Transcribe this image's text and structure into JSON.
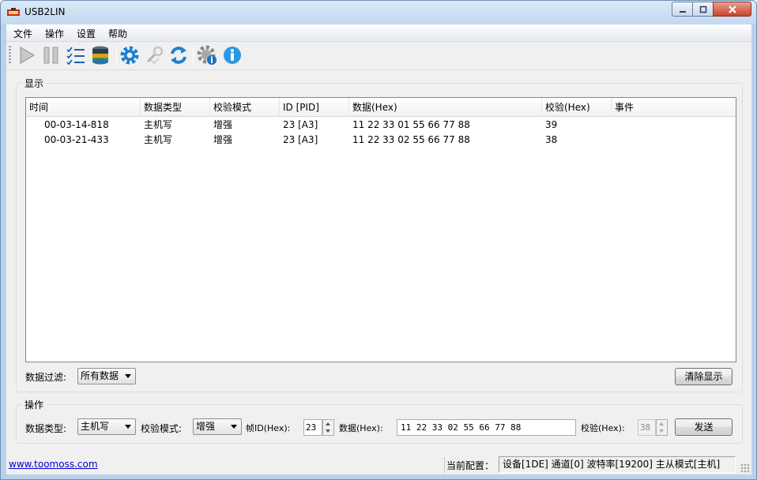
{
  "window": {
    "title": "USB2LIN"
  },
  "menu": [
    "文件",
    "操作",
    "设置",
    "帮助"
  ],
  "toolbar": {
    "icons": [
      "play-icon",
      "pause-icon",
      "checklist-icon",
      "database-icon",
      "gear-icon",
      "wrench-icon",
      "refresh-icon",
      "settings-info-icon",
      "info-icon"
    ]
  },
  "display_group": {
    "label": "显示",
    "columns": [
      "时间",
      "数据类型",
      "校验模式",
      "ID [PID]",
      "数据(Hex)",
      "校验(Hex)",
      "事件"
    ],
    "rows": [
      [
        "00-03-14-818",
        "主机写",
        "增强",
        "23 [A3]",
        "11 22 33 01 55 66 77 88",
        "39",
        ""
      ],
      [
        "00-03-21-433",
        "主机写",
        "增强",
        "23 [A3]",
        "11 22 33 02 55 66 77 88",
        "38",
        ""
      ]
    ],
    "filter_label": "数据过滤:",
    "filter_value": "所有数据",
    "clear_button": "清除显示"
  },
  "operation_group": {
    "label": "操作",
    "data_type_label": "数据类型:",
    "data_type_value": "主机写",
    "check_mode_label": "校验模式:",
    "check_mode_value": "增强",
    "frame_id_label": "帧ID(Hex):",
    "frame_id_value": "23",
    "data_label": "数据(Hex):",
    "data_value": "11 22 33 02 55 66 77 88",
    "checksum_label": "校验(Hex):",
    "checksum_value": "38",
    "send_button": "发送"
  },
  "status": {
    "link": "www.toomoss.com",
    "config_label": "当前配置：",
    "config_value": "设备[1DE] 通道[0] 波特率[19200] 主从模式[主机]"
  },
  "colors": {
    "accent_blue": "#1e7fd0",
    "title_bar": "#c3d9ef",
    "link": "#0000cc"
  }
}
